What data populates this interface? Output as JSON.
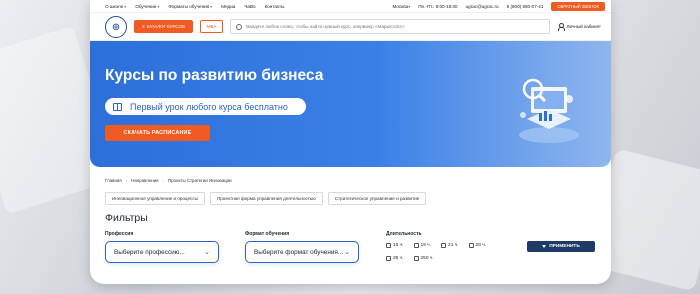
{
  "topbar": {
    "menu": [
      "О школе",
      "Обучение",
      "Форматы обучения",
      "Медиа",
      "ЧаВо",
      "Контакты"
    ],
    "city": "Москва",
    "hours": "Пн.-Пт.: 8:00-18:00",
    "email": "ugrac@ugrac.ru",
    "phone": "8 (800) 550-07-41",
    "callback_label": "ОБРАТНЫЙ ЗВОНОК"
  },
  "header": {
    "catalog_label": "КАТАЛОГ КУРСОВ",
    "mba_label": "MBA",
    "search_placeholder": "Введите любое слово, чтобы найти нужный курс, например «Маркетолог»",
    "cabinet_label": "Личный кабинет"
  },
  "hero": {
    "title": "Курсы по развитию бизнеса",
    "pill_text": "Первый урок любого курса бесплатно",
    "schedule_label": "СКАЧАТЬ РАСПИСАНИЕ"
  },
  "breadcrumb": [
    "Главная",
    "Направления",
    "Проекты Стратегии Инновации"
  ],
  "tags": [
    "Инновационное управление и процессы",
    "Проектная форма управления деятельностью",
    "Стратегическое управление и развитие"
  ],
  "filters": {
    "title": "Фильтры",
    "profession_label": "Профессия",
    "profession_placeholder": "Выберите профессию...",
    "format_label": "Формат обучения",
    "format_placeholder": "Выберите формат обучения...",
    "duration_label": "Длительность",
    "durations": [
      "16 ч.",
      "19 ч.",
      "21 ч.",
      "28 ч.",
      "35 ч.",
      "250 ч."
    ],
    "apply_label": "ПРИМЕНИТЬ"
  },
  "colors": {
    "accent_orange": "#f05a23",
    "hero_blue": "#2d6fd9",
    "apply_navy": "#1f3a66"
  }
}
